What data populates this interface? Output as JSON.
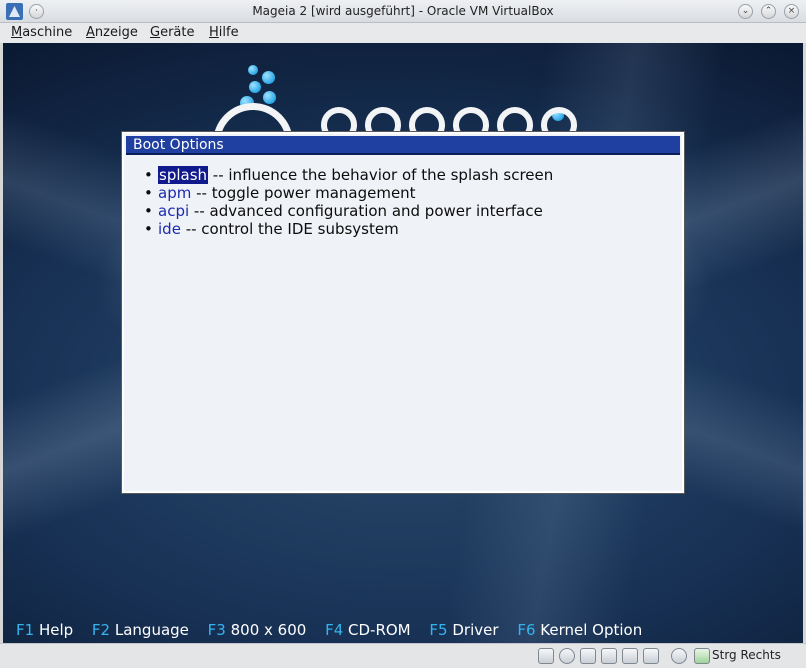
{
  "window": {
    "title": "Mageia 2 [wird ausgeführt] - Oracle VM VirtualBox"
  },
  "menubar": {
    "items": [
      "Maschine",
      "Anzeige",
      "Geräte",
      "Hilfe"
    ]
  },
  "dialog": {
    "title": "Boot Options",
    "options": [
      {
        "key": "splash",
        "desc": " -- influence the behavior of the splash screen",
        "selected": true
      },
      {
        "key": "apm",
        "desc": " -- toggle power management",
        "selected": false
      },
      {
        "key": "acpi",
        "desc": " -- advanced configuration and power interface",
        "selected": false
      },
      {
        "key": "ide",
        "desc": " -- control the IDE subsystem",
        "selected": false
      }
    ]
  },
  "fkeys": [
    {
      "num": "F1",
      "label": " Help"
    },
    {
      "num": "F2",
      "label": " Language"
    },
    {
      "num": "F3",
      "label": " 800 x 600"
    },
    {
      "num": "F4",
      "label": " CD-ROM"
    },
    {
      "num": "F5",
      "label": " Driver"
    },
    {
      "num": "F6",
      "label": " Kernel Option"
    }
  ],
  "statusbar": {
    "host_key": "Strg Rechts",
    "icons": [
      "hard-disk-icon",
      "cd-rom-icon",
      "usb-icon",
      "network-icon",
      "shared-folders-icon",
      "video-capture-icon",
      "virtualization-icon",
      "host-key-icon"
    ]
  }
}
